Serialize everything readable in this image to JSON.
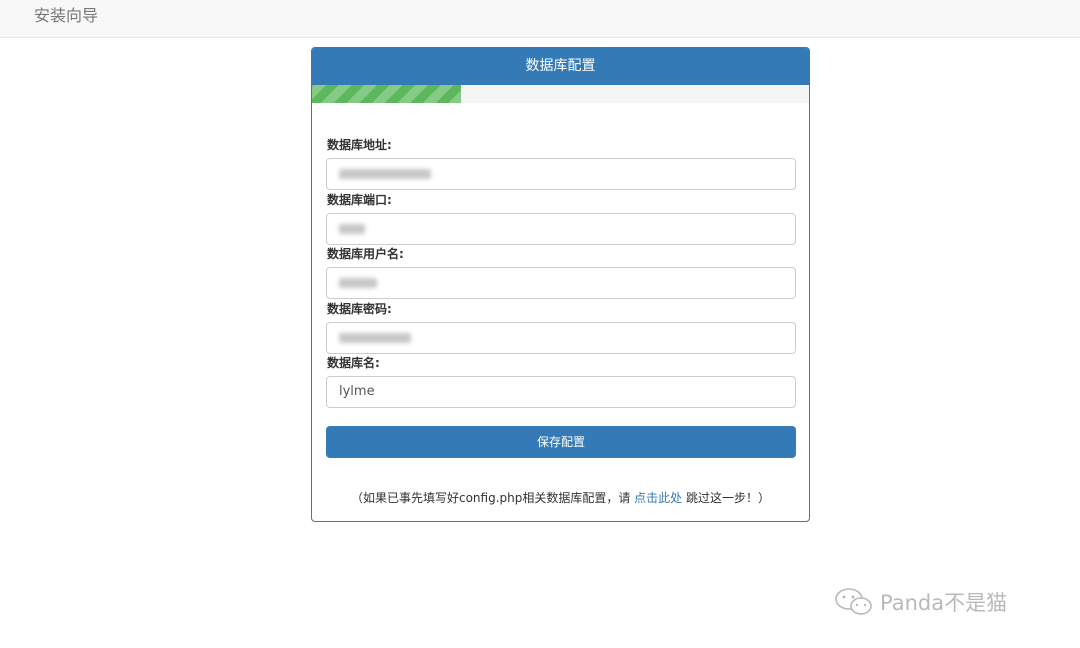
{
  "navbar": {
    "brand": "安装向导"
  },
  "panel": {
    "title": "数据库配置",
    "progress": 0.3,
    "fields": [
      {
        "label": "数据库地址:",
        "value": ""
      },
      {
        "label": "数据库端口:",
        "value": ""
      },
      {
        "label": "数据库用户名:",
        "value": ""
      },
      {
        "label": "数据库密码:",
        "value": ""
      },
      {
        "label": "数据库名:",
        "value": "lylme"
      }
    ],
    "save_button": "保存配置",
    "note_prefix": "（如果已事先填写好config.php相关数据库配置，请 ",
    "note_link": "点击此处",
    "note_suffix": " 跳过这一步！）"
  },
  "watermark": {
    "text": "Panda不是猫"
  },
  "colors": {
    "primary": "#337ab7",
    "progress": "#5cb85c"
  }
}
